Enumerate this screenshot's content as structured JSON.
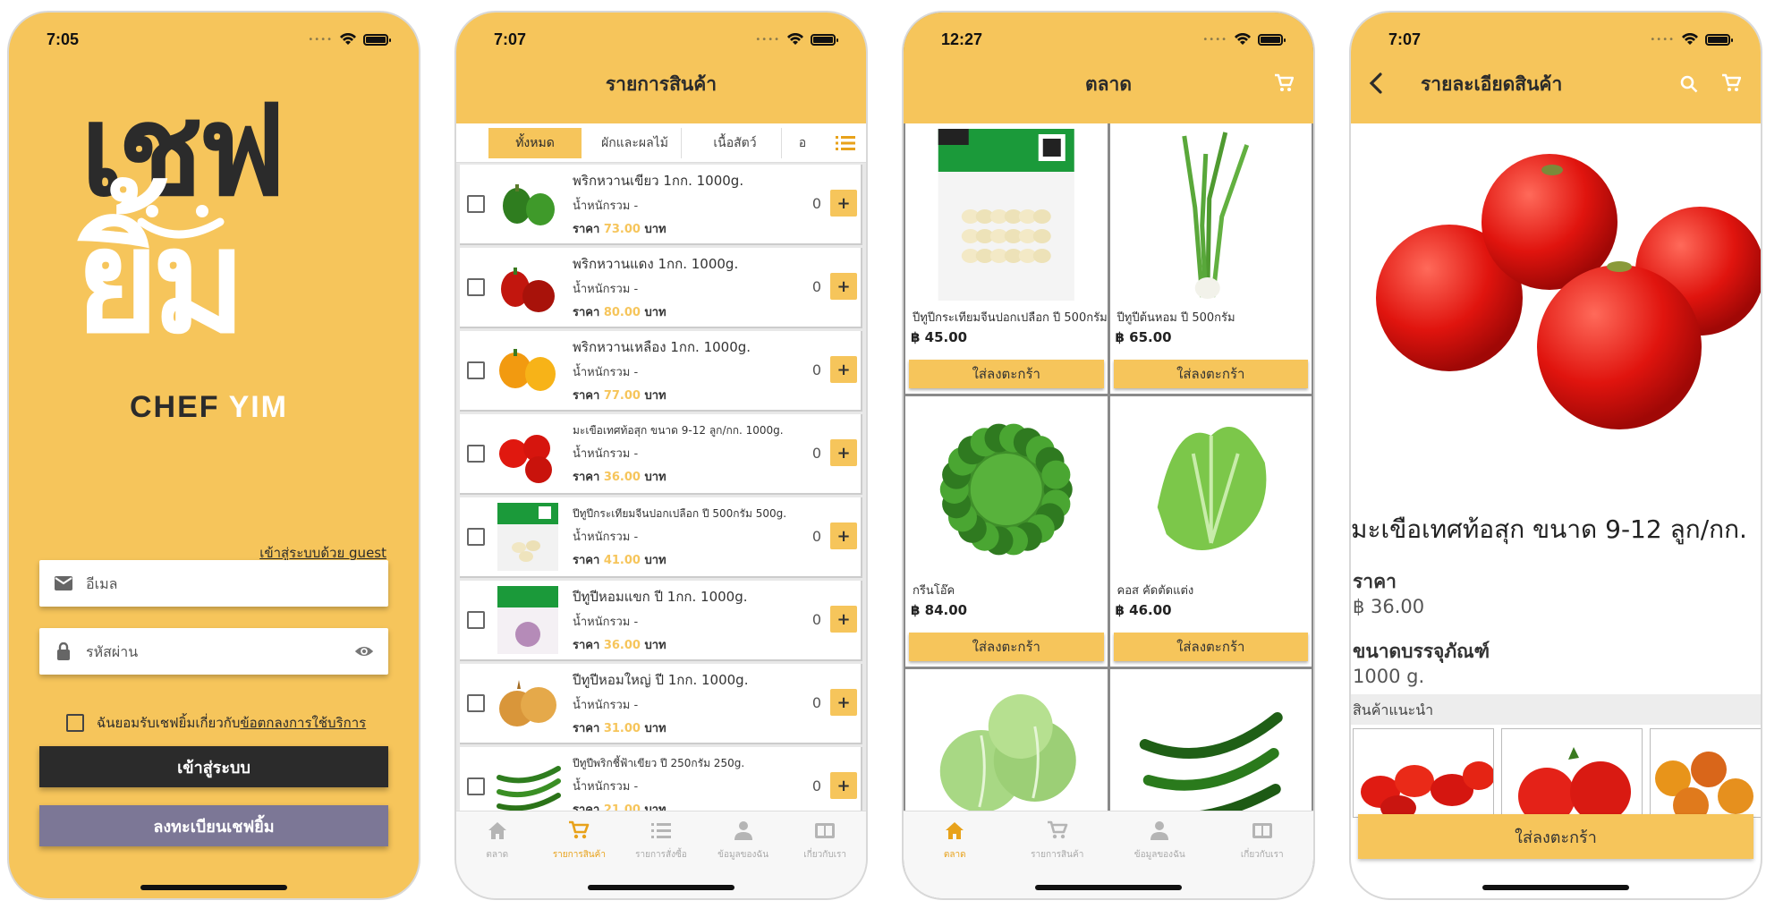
{
  "colors": {
    "accent": "#f6c55b",
    "dark": "#2b2b2b",
    "register": "#7c7796",
    "price": "#f6c55b",
    "tab_active": "#e8a21b"
  },
  "login": {
    "time": "7:05",
    "logo_th_top": "เชฟ",
    "logo_th_bottom": "ยิ้ม",
    "logo_en_a": "CHEF",
    "logo_en_b": "YIM",
    "guest_link": "เข้าสู่ระบบด้วย guest",
    "email_placeholder": "อีเมล",
    "password_placeholder": "รหัสผ่าน",
    "terms_text": "ฉันยอมรับเชฟยิ้มเกี่ยวกับ",
    "terms_link": "ข้อตกลงการใช้บริการ",
    "login_button": "เข้าสู่ระบบ",
    "register_button": "ลงทะเบียนเชฟยิ้ม"
  },
  "product_list": {
    "time": "7:07",
    "title": "รายการสินค้า",
    "tabs": [
      "ทั้งหมด",
      "ผักและผลไม้",
      "เนื้อสัตว์",
      "อ"
    ],
    "weight_label": "น้ำหนักรวม -",
    "price_prefix": "ราคา",
    "price_suffix": "บาท",
    "items": [
      {
        "name": "พริกหวานเขียว 1กก. 1000g.",
        "price": "73.00",
        "qty": "0",
        "thumb": "green-pepper"
      },
      {
        "name": "พริกหวานแดง 1กก. 1000g.",
        "price": "80.00",
        "qty": "0",
        "thumb": "red-pepper"
      },
      {
        "name": "พริกหวานเหลือง 1กก. 1000g.",
        "price": "77.00",
        "qty": "0",
        "thumb": "yellow-pepper"
      },
      {
        "name": "มะเขือเทศท้อสุก ขนาด 9-12 ลูก/กก. 1000g.",
        "price": "36.00",
        "qty": "0",
        "thumb": "tomato"
      },
      {
        "name": "ปีทูปีกระเทียมจีนปอกเปลือก ปี 500กรัม 500g.",
        "price": "41.00",
        "qty": "0",
        "thumb": "garlic-pack"
      },
      {
        "name": "ปีทูปีหอมแขก ปี 1กก. 1000g.",
        "price": "36.00",
        "qty": "0",
        "thumb": "onion-pack"
      },
      {
        "name": "ปีทูปีหอมใหญ่ ปี 1กก. 1000g.",
        "price": "31.00",
        "qty": "0",
        "thumb": "onion"
      },
      {
        "name": "ปีทูปีพริกชี้ฟ้าเขียว ปี 250กรัม 250g.",
        "price": "21.00",
        "qty": "0",
        "thumb": "green-chili"
      }
    ],
    "tabbar": [
      {
        "label": "ตลาด",
        "icon": "home-icon"
      },
      {
        "label": "รายการสินค้า",
        "icon": "cart-icon"
      },
      {
        "label": "รายการสั่งซื้อ",
        "icon": "list-icon"
      },
      {
        "label": "ข้อมูลของฉัน",
        "icon": "user-icon"
      },
      {
        "label": "เกี่ยวกับเรา",
        "icon": "book-icon"
      }
    ]
  },
  "market": {
    "time": "12:27",
    "title": "ตลาด",
    "add_label": "ใส่ลงตะกร้า",
    "items": [
      {
        "name": "ปีทูปีกระเทียมจีนปอกเปลือก ปี 500กรัม",
        "price": "฿ 45.00",
        "img": "garlic-pack"
      },
      {
        "name": "ปีทูปีต้นหอม ปี 500กรัม",
        "price": "฿ 65.00",
        "img": "spring-onion"
      },
      {
        "name": "กรีนโอ๊ค",
        "price": "฿ 84.00",
        "img": "green-oak"
      },
      {
        "name": "คอส คัดตัดแต่ง",
        "price": "฿ 46.00",
        "img": "cos"
      },
      {
        "name": "",
        "price": "",
        "img": "cabbage"
      },
      {
        "name": "",
        "price": "",
        "img": "chili"
      }
    ],
    "tabbar": [
      {
        "label": "ตลาด",
        "icon": "home-icon"
      },
      {
        "label": "รายการสินค้า",
        "icon": "cart-icon"
      },
      {
        "label": "ข้อมูลของฉัน",
        "icon": "user-icon"
      },
      {
        "label": "เกี่ยวกับเรา",
        "icon": "book-icon"
      }
    ]
  },
  "detail": {
    "time": "7:07",
    "title": "รายละเอียดสินค้า",
    "name": "มะเขือเทศท้อสุก ขนาด 9-12 ลูก/กก.",
    "price_label": "ราคา",
    "price_value": "฿ 36.00",
    "size_label": "ขนาดบรรจุภัณฑ์",
    "size_value": "1000 g.",
    "reco_label": "สินค้าแนะนำ",
    "add_button": "ใส่ลงตะกร้า"
  }
}
